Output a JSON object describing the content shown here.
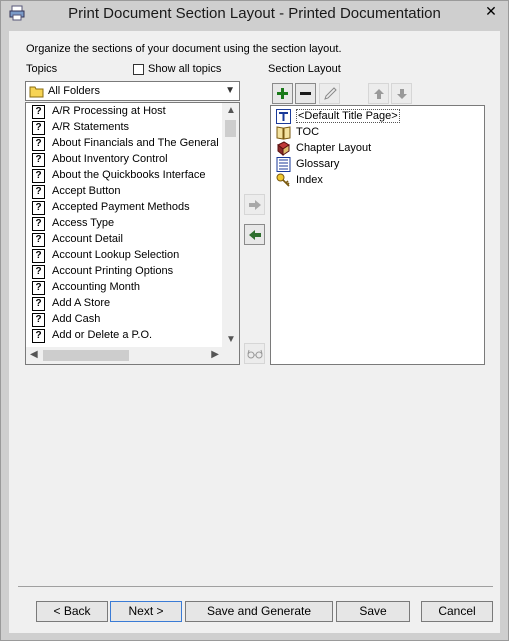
{
  "window": {
    "title": "Print Document Section Layout - Printed Documentation",
    "close_glyph": "✕"
  },
  "instructions": "Organize the sections of your document using the section layout.",
  "topics": {
    "label": "Topics",
    "show_all_label": "Show all topics",
    "folder_value": "All Folders",
    "items": [
      "A/R Processing at Host",
      "A/R Statements",
      "About Financials and The General L",
      "About Inventory Control",
      "About the Quickbooks Interface",
      "Accept Button",
      "Accepted Payment Methods",
      "Access Type",
      "Account Detail",
      "Account Lookup Selection",
      "Account Printing Options",
      "Accounting Month",
      "Add A Store",
      "Add Cash",
      "Add or Delete a P.O."
    ],
    "item_icon": "help-topic-icon"
  },
  "section_layout": {
    "label": "Section Layout",
    "items": [
      {
        "label": "<Default Title Page>",
        "icon": "title-page-icon"
      },
      {
        "label": "TOC",
        "icon": "toc-book-icon"
      },
      {
        "label": "Chapter Layout",
        "icon": "chapter-book-icon"
      },
      {
        "label": "Glossary",
        "icon": "glossary-icon"
      },
      {
        "label": "Index",
        "icon": "index-key-icon"
      }
    ]
  },
  "footer": {
    "back": "< Back",
    "next": "Next >",
    "save_generate": "Save and Generate",
    "save": "Save",
    "cancel": "Cancel"
  },
  "colors": {
    "accent": "#3a7bd5",
    "add_green": "#1a7a1a",
    "arrow_green": "#2e6e2e"
  }
}
